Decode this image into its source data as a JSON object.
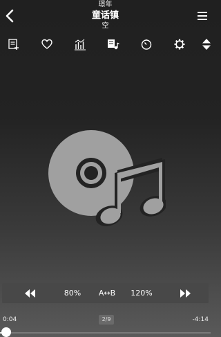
{
  "header": {
    "artist": "璟年",
    "title": "童话镇",
    "album": "空"
  },
  "toolbar": {
    "icons": [
      "playlist-add-icon",
      "heart-icon",
      "equalizer-icon",
      "queue-music-icon",
      "timer-icon",
      "settings-icon",
      "expand-collapse-icon"
    ]
  },
  "controls": {
    "rewind_icon": "rewind-icon",
    "speed_down": "80%",
    "ab_repeat": "A↔B",
    "speed_up": "120%",
    "forward_icon": "fast-forward-icon"
  },
  "progress": {
    "elapsed": "0:04",
    "remaining": "-4:14",
    "position": "2/9",
    "fraction": 0.016
  },
  "colors": {
    "background_top": "#202020",
    "background_bottom": "#5a5a5a",
    "art": "#a0a0a0",
    "control_bar": "#484848"
  }
}
